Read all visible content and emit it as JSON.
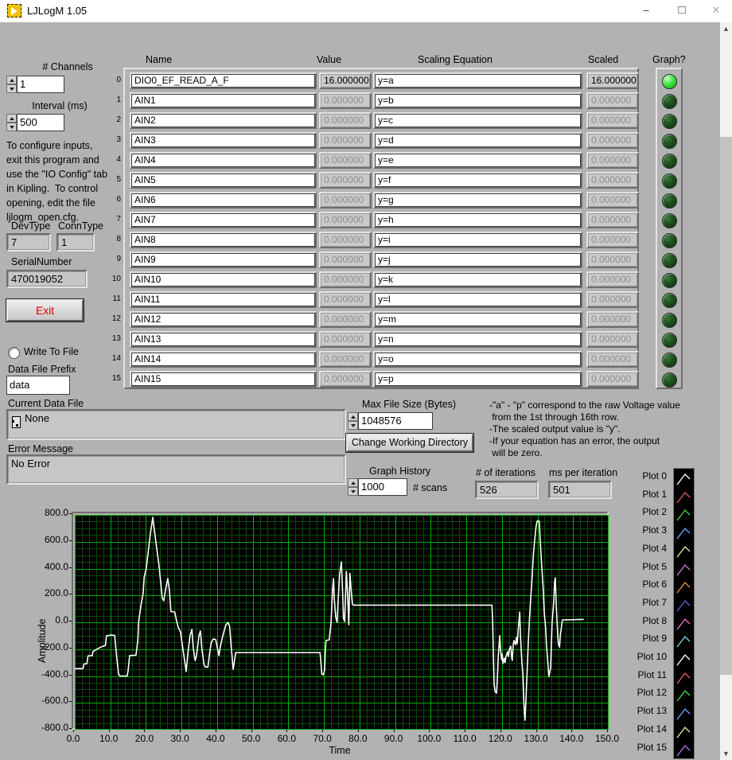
{
  "window": {
    "title": "LJLogM 1.05",
    "controls": {
      "minimize_icon": "–",
      "maximize_icon": "□",
      "close_icon": "✕"
    },
    "scrollbar": {
      "up_icon": "▲",
      "down_icon": "▼"
    }
  },
  "left_panel": {
    "channels_label": "# Channels",
    "channels_value": "1",
    "interval_label": "Interval (ms)",
    "interval_value": "500",
    "info_text": "To configure inputs,\nexit this program and\nuse the \"IO Config\" tab\nin Kipling.  To control\nopening, edit the file\nljlogm_open.cfg.",
    "devtype_label": "DevType",
    "devtype_value": "7",
    "conntype_label": "ConnType",
    "conntype_value": "1",
    "serial_label": "SerialNumber",
    "serial_value": "470019052",
    "exit_label": "Exit",
    "write_to_file_label": "Write To File",
    "data_file_prefix_label": "Data File Prefix",
    "data_file_prefix_value": "data"
  },
  "files": {
    "current_data_file_label": "Current Data File",
    "current_data_file_value": "None",
    "error_message_label": "Error Message",
    "error_message_value": "No Error",
    "max_file_size_label": "Max File Size (Bytes)",
    "max_file_size_value": "1048576",
    "change_dir_button": "Change Working Directory",
    "notes_text": "-\"a\" - \"p\" correspond to the raw Voltage value\n from the 1st through 16th row.\n-The scaled output value is \"y\".\n-If your equation has an error, the output\n will be zero.",
    "graph_history_label": "Graph History",
    "graph_history_value": "1000",
    "scans_label": "# scans",
    "iterations_label": "# of iterations",
    "iterations_value": "526",
    "ms_per_iter_label": "ms per iteration",
    "ms_per_iter_value": "501"
  },
  "table": {
    "headers": {
      "name": "Name",
      "value": "Value",
      "scaling": "Scaling Equation",
      "scaled": "Scaled",
      "graph": "Graph?"
    },
    "rows": [
      {
        "index": 0,
        "name": "DIO0_EF_READ_A_F",
        "value": "16.000000",
        "equation": "y=a",
        "scaled": "16.000000",
        "led_on": true
      },
      {
        "index": 1,
        "name": "AIN1",
        "value": "0.000000",
        "equation": "y=b",
        "scaled": "0.000000",
        "led_on": false
      },
      {
        "index": 2,
        "name": "AIN2",
        "value": "0.000000",
        "equation": "y=c",
        "scaled": "0.000000",
        "led_on": false
      },
      {
        "index": 3,
        "name": "AIN3",
        "value": "0.000000",
        "equation": "y=d",
        "scaled": "0.000000",
        "led_on": false
      },
      {
        "index": 4,
        "name": "AIN4",
        "value": "0.000000",
        "equation": "y=e",
        "scaled": "0.000000",
        "led_on": false
      },
      {
        "index": 5,
        "name": "AIN5",
        "value": "0.000000",
        "equation": "y=f",
        "scaled": "0.000000",
        "led_on": false
      },
      {
        "index": 6,
        "name": "AIN6",
        "value": "0.000000",
        "equation": "y=g",
        "scaled": "0.000000",
        "led_on": false
      },
      {
        "index": 7,
        "name": "AIN7",
        "value": "0.000000",
        "equation": "y=h",
        "scaled": "0.000000",
        "led_on": false
      },
      {
        "index": 8,
        "name": "AIN8",
        "value": "0.000000",
        "equation": "y=i",
        "scaled": "0.000000",
        "led_on": false
      },
      {
        "index": 9,
        "name": "AIN9",
        "value": "0.000000",
        "equation": "y=j",
        "scaled": "0.000000",
        "led_on": false
      },
      {
        "index": 10,
        "name": "AIN10",
        "value": "0.000000",
        "equation": "y=k",
        "scaled": "0.000000",
        "led_on": false
      },
      {
        "index": 11,
        "name": "AIN11",
        "value": "0.000000",
        "equation": "y=l",
        "scaled": "0.000000",
        "led_on": false
      },
      {
        "index": 12,
        "name": "AIN12",
        "value": "0.000000",
        "equation": "y=m",
        "scaled": "0.000000",
        "led_on": false
      },
      {
        "index": 13,
        "name": "AIN13",
        "value": "0.000000",
        "equation": "y=n",
        "scaled": "0.000000",
        "led_on": false
      },
      {
        "index": 14,
        "name": "AIN14",
        "value": "0.000000",
        "equation": "y=o",
        "scaled": "0.000000",
        "led_on": false
      },
      {
        "index": 15,
        "name": "AIN15",
        "value": "0.000000",
        "equation": "y=p",
        "scaled": "0.000000",
        "led_on": false
      }
    ]
  },
  "chart_data": {
    "type": "line",
    "xlabel": "Time",
    "ylabel": "Amplitude",
    "xlim": [
      0,
      150
    ],
    "ylim": [
      -800,
      800
    ],
    "x_ticks": [
      "0.0",
      "10.0",
      "20.0",
      "30.0",
      "40.0",
      "50.0",
      "60.0",
      "70.0",
      "80.0",
      "90.0",
      "100.0",
      "110.0",
      "120.0",
      "130.0",
      "140.0",
      "150.0"
    ],
    "y_ticks": [
      "800.0",
      "600.0",
      "400.0",
      "200.0",
      "0.0",
      "-200.0",
      "-400.0",
      "-600.0",
      "-800.0"
    ],
    "grid": {
      "bg": "#000000",
      "major_color": "#00ad00",
      "minor_color": "#0b4a0b",
      "x_major": 10,
      "x_minor": 2,
      "y_major": 200,
      "y_minor": 50
    },
    "line_color": "#ffffff",
    "legend_position": "right",
    "legend": [
      {
        "label": "Plot 0",
        "color": "#ffffff"
      },
      {
        "label": "Plot 1",
        "color": "#e05c5c"
      },
      {
        "label": "Plot 2",
        "color": "#3fd43f"
      },
      {
        "label": "Plot 3",
        "color": "#63a8ff"
      },
      {
        "label": "Plot 4",
        "color": "#e7e79b"
      },
      {
        "label": "Plot 5",
        "color": "#cc6fcc"
      },
      {
        "label": "Plot 6",
        "color": "#de9440"
      },
      {
        "label": "Plot 7",
        "color": "#5560e0"
      },
      {
        "label": "Plot 8",
        "color": "#e772c8"
      },
      {
        "label": "Plot 9",
        "color": "#6cd9d9"
      },
      {
        "label": "Plot 10",
        "color": "#ffffff"
      },
      {
        "label": "Plot 11",
        "color": "#e05c5c"
      },
      {
        "label": "Plot 12",
        "color": "#3fd43f"
      },
      {
        "label": "Plot 13",
        "color": "#63a8ff"
      },
      {
        "label": "Plot 14",
        "color": "#e7e79b"
      },
      {
        "label": "Plot 15",
        "color": "#b867de"
      }
    ],
    "series": [
      {
        "name": "Plot 0",
        "points": [
          [
            0,
            -345
          ],
          [
            2.3,
            -345
          ],
          [
            2.6,
            -310
          ],
          [
            3.4,
            -308
          ],
          [
            3.7,
            -250
          ],
          [
            4.9,
            -248
          ],
          [
            5.1,
            -218
          ],
          [
            6.2,
            -200
          ],
          [
            7.4,
            -183
          ],
          [
            8.6,
            -172
          ],
          [
            8.9,
            -100
          ],
          [
            10.2,
            -95
          ],
          [
            11.2,
            -97
          ],
          [
            11.8,
            -267
          ],
          [
            12.3,
            -385
          ],
          [
            12.7,
            -400
          ],
          [
            14.7,
            -400
          ],
          [
            15,
            -356
          ],
          [
            15.4,
            -248
          ],
          [
            17.2,
            -245
          ],
          [
            17.7,
            -136
          ],
          [
            17.9,
            0
          ],
          [
            18.6,
            128
          ],
          [
            19.2,
            217
          ],
          [
            19.5,
            336
          ],
          [
            20.1,
            404
          ],
          [
            20.6,
            520
          ],
          [
            21.2,
            652
          ],
          [
            21.9,
            781
          ],
          [
            22.4,
            681
          ],
          [
            23,
            553
          ],
          [
            23.6,
            435
          ],
          [
            24.1,
            308
          ],
          [
            24.6,
            178
          ],
          [
            25,
            160
          ],
          [
            25.6,
            256
          ],
          [
            26.1,
            326
          ],
          [
            26.6,
            237
          ],
          [
            27,
            80
          ],
          [
            28.1,
            77
          ],
          [
            28.6,
            12
          ],
          [
            29.1,
            -41
          ],
          [
            29.7,
            -71
          ],
          [
            30.2,
            -166
          ],
          [
            30.6,
            -237
          ],
          [
            31.3,
            -367
          ],
          [
            31.8,
            -219
          ],
          [
            32.4,
            -99
          ],
          [
            32.9,
            -53
          ],
          [
            33.3,
            -196
          ],
          [
            33.8,
            -284
          ],
          [
            34.2,
            -248
          ],
          [
            34.9,
            -99
          ],
          [
            35.3,
            -65
          ],
          [
            35.7,
            -196
          ],
          [
            36.3,
            -314
          ],
          [
            36.7,
            -333
          ],
          [
            37.4,
            -333
          ],
          [
            37.8,
            -248
          ],
          [
            38.3,
            -154
          ],
          [
            38.9,
            -124
          ],
          [
            39.6,
            -128
          ],
          [
            40.1,
            -196
          ],
          [
            40.5,
            -248
          ],
          [
            40.9,
            -178
          ],
          [
            41.6,
            -99
          ],
          [
            42,
            -59
          ],
          [
            42.5,
            -18
          ],
          [
            43,
            0
          ],
          [
            43.5,
            -30
          ],
          [
            44,
            -196
          ],
          [
            44.5,
            -350
          ],
          [
            44.9,
            -278
          ],
          [
            45.2,
            -225
          ],
          [
            68.9,
            -225
          ],
          [
            69.1,
            -278
          ],
          [
            69.4,
            -385
          ],
          [
            69.8,
            -391
          ],
          [
            70.2,
            -356
          ],
          [
            70.4,
            -200
          ],
          [
            70.6,
            -136
          ],
          [
            71.5,
            -130
          ],
          [
            72,
            0
          ],
          [
            72.4,
            237
          ],
          [
            72.7,
            326
          ],
          [
            72.9,
            178
          ],
          [
            73.3,
            41
          ],
          [
            73.7,
            0
          ],
          [
            74,
            160
          ],
          [
            74.4,
            355
          ],
          [
            74.9,
            450
          ],
          [
            75.2,
            256
          ],
          [
            75.5,
            30
          ],
          [
            75.8,
            6
          ],
          [
            76.1,
            219
          ],
          [
            76.3,
            379
          ],
          [
            76.7,
            178
          ],
          [
            77,
            -18
          ],
          [
            77.3,
            365
          ],
          [
            77.7,
            219
          ],
          [
            78,
            136
          ],
          [
            78.3,
            128
          ],
          [
            117.2,
            128
          ],
          [
            117.4,
            0
          ],
          [
            117.6,
            -255
          ],
          [
            117.8,
            -462
          ],
          [
            118.1,
            -516
          ],
          [
            118.5,
            -527
          ],
          [
            118.7,
            -433
          ],
          [
            119,
            -248
          ],
          [
            119.4,
            -99
          ],
          [
            119.6,
            -196
          ],
          [
            119.9,
            -278
          ],
          [
            120.1,
            -237
          ],
          [
            120.3,
            -306
          ],
          [
            120.7,
            -267
          ],
          [
            120.9,
            -300
          ],
          [
            121.2,
            -248
          ],
          [
            121.6,
            -219
          ],
          [
            121.8,
            -255
          ],
          [
            122.1,
            -200
          ],
          [
            122.5,
            -178
          ],
          [
            122.7,
            -255
          ],
          [
            122.9,
            -284
          ],
          [
            123.2,
            -166
          ],
          [
            123.4,
            -136
          ],
          [
            123.8,
            -166
          ],
          [
            124.1,
            -112
          ],
          [
            124.3,
            -160
          ],
          [
            124.7,
            -18
          ],
          [
            125,
            77
          ],
          [
            125.2,
            -99
          ],
          [
            125.6,
            -296
          ],
          [
            125.9,
            -397
          ],
          [
            126.1,
            -551
          ],
          [
            126.3,
            -670
          ],
          [
            126.5,
            -729
          ],
          [
            126.8,
            -551
          ],
          [
            127.1,
            -356
          ],
          [
            127.4,
            -160
          ],
          [
            127.7,
            0
          ],
          [
            128.1,
            178
          ],
          [
            128.5,
            336
          ],
          [
            128.8,
            492
          ],
          [
            129.2,
            612
          ],
          [
            129.6,
            711
          ],
          [
            129.9,
            754
          ],
          [
            130.5,
            754
          ],
          [
            130.8,
            593
          ],
          [
            131.2,
            415
          ],
          [
            131.6,
            256
          ],
          [
            131.9,
            77
          ],
          [
            132.3,
            -41
          ],
          [
            132.5,
            -160
          ],
          [
            132.9,
            -296
          ],
          [
            133.2,
            -403
          ],
          [
            133.7,
            -338
          ],
          [
            133.9,
            -160
          ],
          [
            134.1,
            0
          ],
          [
            134.6,
            160
          ],
          [
            134.8,
            296
          ],
          [
            135,
            332
          ],
          [
            135.3,
            118
          ],
          [
            135.7,
            -99
          ],
          [
            135.9,
            -166
          ],
          [
            136.2,
            -184
          ],
          [
            136.4,
            -99
          ],
          [
            136.8,
            -18
          ],
          [
            137,
            18
          ],
          [
            143,
            22
          ]
        ]
      }
    ]
  }
}
